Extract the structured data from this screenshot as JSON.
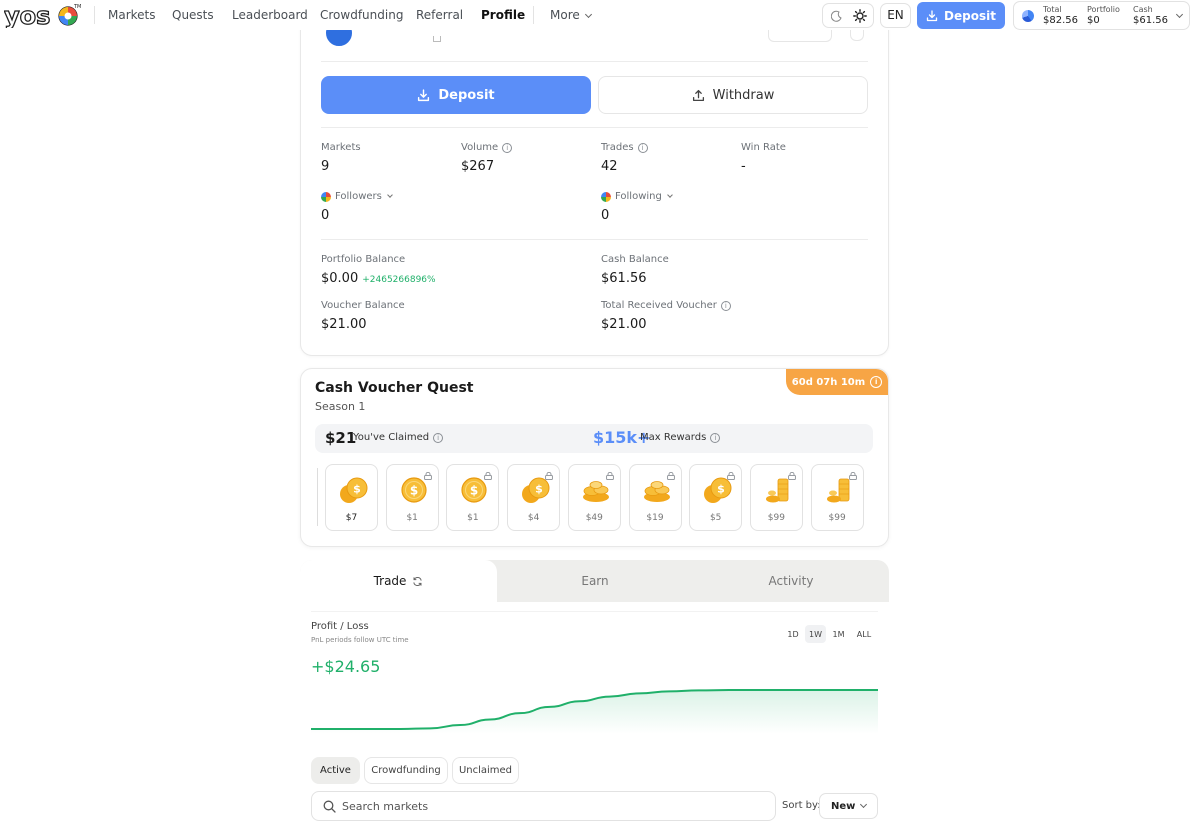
{
  "nav": {
    "items": [
      {
        "label": "Markets"
      },
      {
        "label": "Quests"
      },
      {
        "label": "Leaderboard"
      },
      {
        "label": "Crowdfunding"
      },
      {
        "label": "Referral"
      },
      {
        "label": "Profile"
      },
      {
        "label": "More"
      }
    ],
    "active": "Profile",
    "lang": "EN",
    "deposit_label": "Deposit",
    "wallet": {
      "total_label": "Total",
      "total_value": "$82.56",
      "portfolio_label": "Portfolio",
      "portfolio_value": "$0",
      "cash_label": "Cash",
      "cash_value": "$61.56"
    }
  },
  "profile": {
    "deposit_label": "Deposit",
    "withdraw_label": "Withdraw",
    "stats": {
      "markets": {
        "label": "Markets",
        "value": "9"
      },
      "volume": {
        "label": "Volume",
        "value": "$267"
      },
      "trades": {
        "label": "Trades",
        "value": "42"
      },
      "win_rate": {
        "label": "Win Rate",
        "value": "-"
      },
      "followers": {
        "label": "Followers",
        "value": "0"
      },
      "following": {
        "label": "Following",
        "value": "0"
      }
    },
    "balances": {
      "portfolio": {
        "label": "Portfolio Balance",
        "value": "$0.00",
        "change": "+2465266896%"
      },
      "cash": {
        "label": "Cash Balance",
        "value": "$61.56"
      },
      "voucher": {
        "label": "Voucher Balance",
        "value": "$21.00"
      },
      "total_received": {
        "label": "Total Received Voucher",
        "value": "$21.00"
      }
    }
  },
  "quest": {
    "title": "Cash Voucher Quest",
    "season": "Season 1",
    "timer": "60d 07h 10m",
    "claimed_amount": "$21",
    "claimed_label": "You've Claimed",
    "max_amount": "$15k+",
    "max_label": "Max Rewards",
    "rewards": [
      {
        "value": "$7",
        "locked": false,
        "art": "coin-stack-icon"
      },
      {
        "value": "$1",
        "locked": true,
        "art": "coin-icon"
      },
      {
        "value": "$1",
        "locked": true,
        "art": "coin-icon"
      },
      {
        "value": "$4",
        "locked": true,
        "art": "coin-stack-icon"
      },
      {
        "value": "$49",
        "locked": true,
        "art": "coin-pile-icon"
      },
      {
        "value": "$19",
        "locked": true,
        "art": "coin-pile-icon"
      },
      {
        "value": "$5",
        "locked": true,
        "art": "coin-stack-icon"
      },
      {
        "value": "$99",
        "locked": true,
        "art": "coin-tower-icon"
      },
      {
        "value": "$99",
        "locked": true,
        "art": "coin-tower-icon"
      }
    ]
  },
  "tabs": [
    {
      "label": "Trade"
    },
    {
      "label": "Earn"
    },
    {
      "label": "Activity"
    }
  ],
  "pnl": {
    "title": "Profit / Loss",
    "subtitle": "PnL periods follow UTC time",
    "value": "+$24.65",
    "periods": [
      "1D",
      "1W",
      "1M",
      "ALL"
    ],
    "active_period": "1W",
    "series": [
      0,
      0,
      0,
      0,
      0.4,
      2.5,
      6,
      10,
      14,
      17.5,
      20.5,
      22.5,
      23.8,
      24.4,
      24.65,
      24.65,
      24.65,
      24.65,
      24.65,
      24.65
    ],
    "line_color": "#20b06a"
  },
  "filters": {
    "chips": [
      "Active",
      "Crowdfunding",
      "Unclaimed"
    ],
    "active": "Active",
    "search_placeholder": "Search markets",
    "sort_label": "Sort by:",
    "sort_value": "New"
  },
  "colors": {
    "accent": "#5b8ef8",
    "positive": "#20b06a",
    "timer": "#f7a545"
  }
}
